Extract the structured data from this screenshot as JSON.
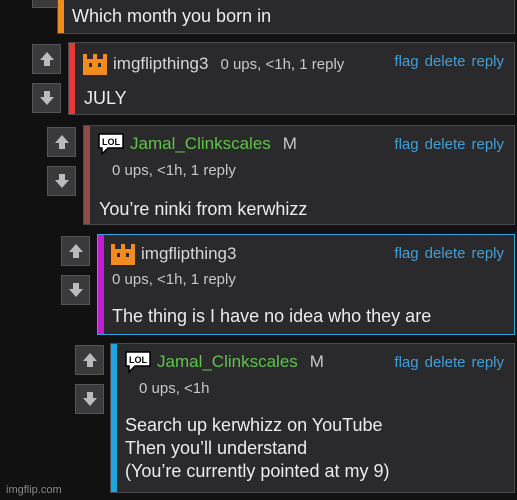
{
  "top_comment": {
    "text": "Which month you born in",
    "bar_color": "#f28c1e"
  },
  "comments": [
    {
      "username": "imgflipthing3",
      "username_color": "#d6d6d6",
      "meta": "0 ups, <1h, 1 reply",
      "text_lines": [
        "JULY"
      ],
      "bar_color": "#e53935",
      "avatar": "orange-castle-avatar-icon",
      "actions": [
        "flag",
        "delete",
        "reply"
      ]
    },
    {
      "username": "Jamal_Clinkscales",
      "badge": "M",
      "username_color": "#5fc24a",
      "meta": "0 ups, <1h, 1 reply",
      "text_lines": [
        "You’re ninki from kerwhizz"
      ],
      "bar_color": "#8a4f45",
      "avatar": "lol-speech-bubble-icon",
      "avatar_text": "LOL",
      "actions": [
        "flag",
        "delete",
        "reply"
      ]
    },
    {
      "username": "imgflipthing3",
      "username_color": "#d6d6d6",
      "meta": "0 ups, <1h, 1 reply",
      "text_lines": [
        "The thing is I have no idea who they are"
      ],
      "bar_color": "#c21bd6",
      "border_color": "#3aa0e0",
      "avatar": "orange-castle-avatar-icon",
      "actions": [
        "flag",
        "delete",
        "reply"
      ]
    },
    {
      "username": "Jamal_Clinkscales",
      "badge": "M",
      "username_color": "#5fc24a",
      "meta": "0 ups, <1h",
      "text_lines": [
        "Search up kerwhizz on YouTube",
        "Then you’ll understand",
        "(You’re currently pointed at my 9)"
      ],
      "bar_color": "#1aa7e0",
      "avatar": "lol-speech-bubble-icon",
      "avatar_text": "LOL",
      "actions": [
        "flag",
        "delete",
        "reply"
      ]
    }
  ],
  "watermark": "imgflip.com"
}
